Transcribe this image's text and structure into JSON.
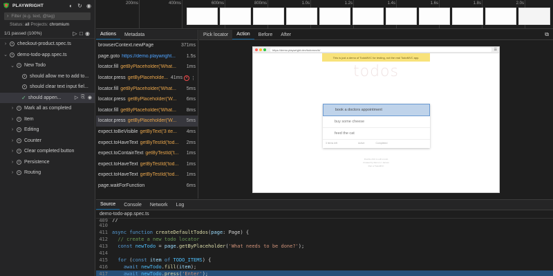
{
  "app": {
    "title": "PLAYWRIGHT"
  },
  "sidebar": {
    "filter_placeholder": "Filter (e.g. text, @tag)",
    "status_label": "Status:",
    "status_value": "all",
    "projects_label": "Projects:",
    "projects_value": "chromium",
    "summary": "1/1 passed (100%)",
    "items": [
      {
        "label": "checkout-product.spec.ts",
        "expand": "›"
      },
      {
        "label": "demo-todo-app.spec.ts",
        "expand": "⌄"
      },
      {
        "label": "New Todo",
        "expand": "⌄"
      },
      {
        "label": "should allow me to add to..."
      },
      {
        "label": "should clear text input fiel..."
      },
      {
        "label": "should appen..."
      },
      {
        "label": "Mark all as completed",
        "expand": "›"
      },
      {
        "label": "Item",
        "expand": "›"
      },
      {
        "label": "Editing",
        "expand": "›"
      },
      {
        "label": "Counter",
        "expand": "›"
      },
      {
        "label": "Clear completed button",
        "expand": "›"
      },
      {
        "label": "Persistence",
        "expand": "›"
      },
      {
        "label": "Routing",
        "expand": "›"
      }
    ]
  },
  "timeline": {
    "ticks": [
      "200ms",
      "400ms",
      "600ms",
      "800ms",
      "1.0s",
      "1.2s",
      "1.4s",
      "1.6s",
      "1.8s",
      "2.0s"
    ]
  },
  "actions_panel": {
    "tabs": [
      "Actions",
      "Metadata"
    ],
    "rows": [
      {
        "method": "browserContext.newPage",
        "arg": "",
        "duration": "371ms"
      },
      {
        "method": "page.goto",
        "arg": "https://demo.playwright...",
        "duration": "1.5s"
      },
      {
        "method": "locator.fill",
        "arg": "getByPlaceholder('What...",
        "duration": "1ms"
      },
      {
        "method": "locator.press",
        "arg": "getByPlaceholde...",
        "duration": "41ms"
      },
      {
        "method": "locator.fill",
        "arg": "getByPlaceholder('What...",
        "duration": "5ms"
      },
      {
        "method": "locator.press",
        "arg": "getByPlaceholder('W...",
        "duration": "6ms"
      },
      {
        "method": "locator.fill",
        "arg": "getByPlaceholder('What...",
        "duration": "8ms"
      },
      {
        "method": "locator.press",
        "arg": "getByPlaceholder('W...",
        "duration": "5ms"
      },
      {
        "method": "expect.toBeVisible",
        "arg": "getByText('3 ite...",
        "duration": "4ms"
      },
      {
        "method": "expect.toHaveText",
        "arg": "getByTestId('tod...",
        "duration": "2ms"
      },
      {
        "method": "expect.toContainText",
        "arg": "getByTestId('t...",
        "duration": "1ms"
      },
      {
        "method": "expect.toHaveText",
        "arg": "getByTestId('tod...",
        "duration": "1ms"
      },
      {
        "method": "expect.toHaveText",
        "arg": "getByTestId('tod...",
        "duration": "1ms"
      },
      {
        "method": "page.waitForFunction",
        "arg": "",
        "duration": "6ms"
      }
    ]
  },
  "snapshot_panel": {
    "tabs": [
      "Pick locator",
      "Action",
      "Before",
      "After"
    ],
    "browser_url": "https://demo.playwright.dev/todomvc/#/",
    "banner": "This is just a demo of TodoMVC for testing, not the real TodoMVC app.",
    "app_title": "todos",
    "input_value": "book a doctors appointment",
    "todos": [
      "buy some cheese",
      "feed the cat"
    ],
    "footer_count": "3 items left",
    "footer_filters": [
      "Active",
      "Completed"
    ],
    "page_footer": [
      "Double-click to edit a todo",
      "Created by Remo H. Jansen",
      "Part of TodoMVC"
    ]
  },
  "bottom_panel": {
    "tabs": [
      "Source",
      "Console",
      "Network",
      "Log"
    ],
    "filename": "demo-todo-app.spec.ts",
    "line_numbers": [
      "409",
      "410",
      "411",
      "412",
      "413",
      "414",
      "415",
      "416",
      "417",
      "418"
    ]
  },
  "colors": {
    "accent_blue": "#0e639c",
    "selector_orange": "#e8a54b",
    "link_blue": "#4fa3ff",
    "highlight": "#264f78",
    "error_red": "#f14c4c",
    "pass_green": "#73c991"
  }
}
